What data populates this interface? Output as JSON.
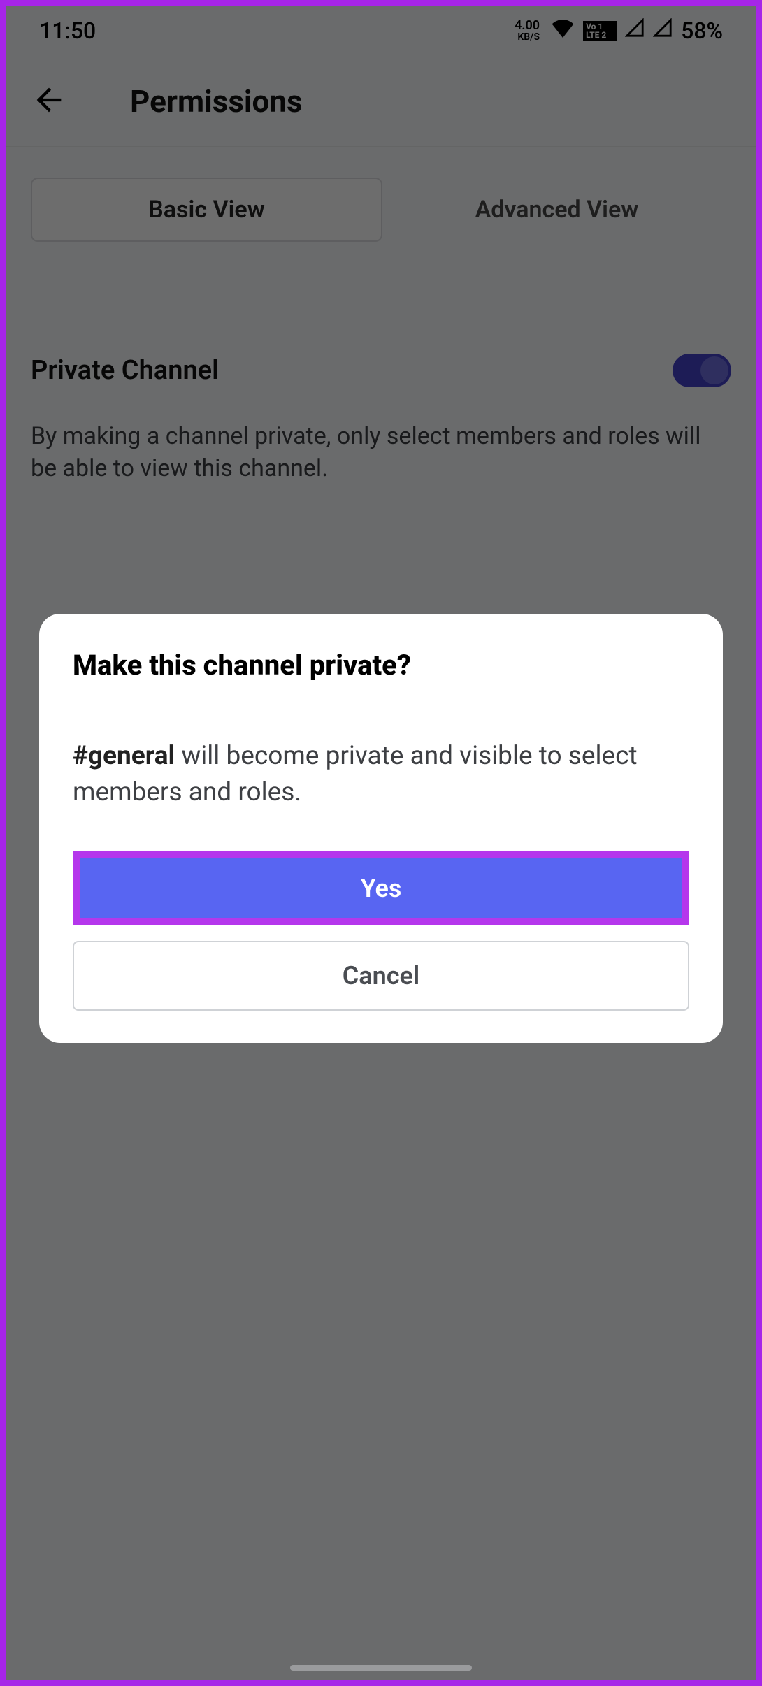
{
  "status": {
    "time": "11:50",
    "data_rate_value": "4.00",
    "data_rate_unit": "KB/S",
    "lte_badge": "Vo 1 LTE 2",
    "battery": "58%"
  },
  "header": {
    "title": "Permissions"
  },
  "tabs": {
    "basic": "Basic View",
    "advanced": "Advanced View"
  },
  "section": {
    "title": "Private Channel",
    "description": "By making a channel private, only select members and roles will be able to view this channel."
  },
  "dialog": {
    "title": "Make this channel private?",
    "body_bold": "#general",
    "body_rest": " will become private and visible to select members and roles.",
    "yes": "Yes",
    "cancel": "Cancel"
  }
}
